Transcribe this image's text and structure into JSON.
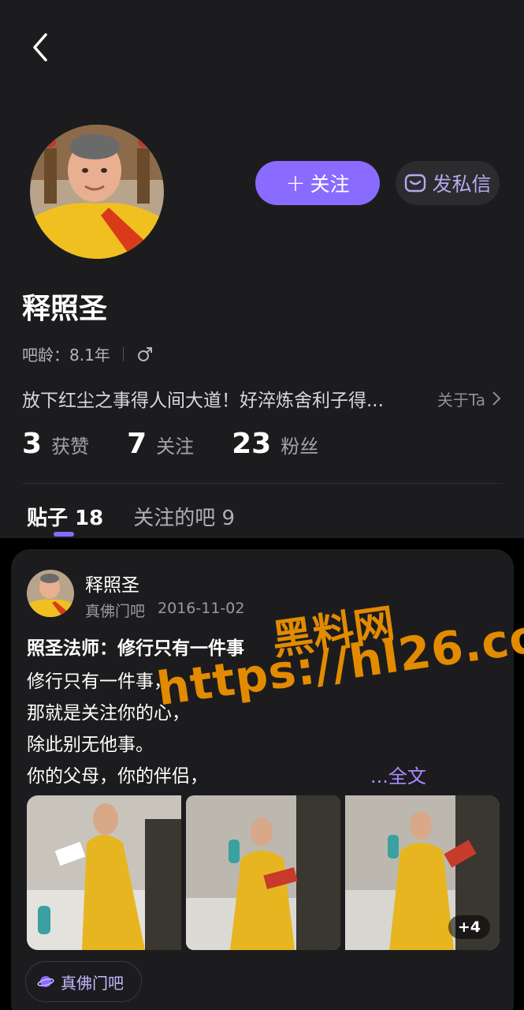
{
  "profile": {
    "name": "释照圣",
    "age_label": "吧龄：8.1年",
    "gender_icon": "male-icon",
    "bio": "放下红尘之事得人间大道！好淬炼舍利子得...",
    "about_label": "关于Ta",
    "follow_label": "关注",
    "message_label": "发私信"
  },
  "stats": [
    {
      "num": "3",
      "label": "获赞"
    },
    {
      "num": "7",
      "label": "关注"
    },
    {
      "num": "23",
      "label": "粉丝"
    }
  ],
  "tabs": [
    {
      "label": "贴子 18",
      "active": true
    },
    {
      "label": "关注的吧 9",
      "active": false
    }
  ],
  "post": {
    "author": "释照圣",
    "forum": "真佛门吧",
    "date": "2016-11-02",
    "title": "照圣法师：修行只有一件事",
    "lines": [
      "修行只有一件事，",
      "那就是关注你的心，",
      "除此别无他事。",
      "你的父母，你的伴侣，"
    ],
    "more_label": "...全文",
    "extra_images": "+4",
    "chip_label": "真佛门吧"
  },
  "watermark": {
    "line1": "黑料网",
    "line2": "https://hl26.co"
  },
  "colors": {
    "accent": "#8a6bff",
    "background": "#1c1c1e",
    "robe": "#e5b020"
  }
}
